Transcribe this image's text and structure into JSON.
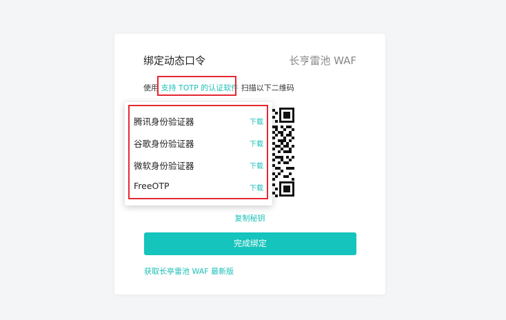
{
  "card": {
    "title": "绑定动态口令",
    "brand": "长亨雷池 WAF",
    "instruction": {
      "prefix": "使用",
      "link": "支持 TOTP 的认证软件",
      "suffix": "扫描以下二维码"
    },
    "copy_secret": "复制秘钥",
    "finish_button": "完成绑定",
    "latest_link": "获取长亭雷池 WAF 最新版"
  },
  "dropdown": {
    "items": [
      {
        "name": "腾讯身份验证器",
        "download": "下载"
      },
      {
        "name": "谷歌身份验证器",
        "download": "下载"
      },
      {
        "name": "微软身份验证器",
        "download": "下载"
      },
      {
        "name": "FreeOTP",
        "download": "下载"
      }
    ]
  },
  "colors": {
    "accent": "#15c4bc",
    "link": "#1cbfb7",
    "highlight_border": "#e52630",
    "background": "#f4f5f7"
  }
}
